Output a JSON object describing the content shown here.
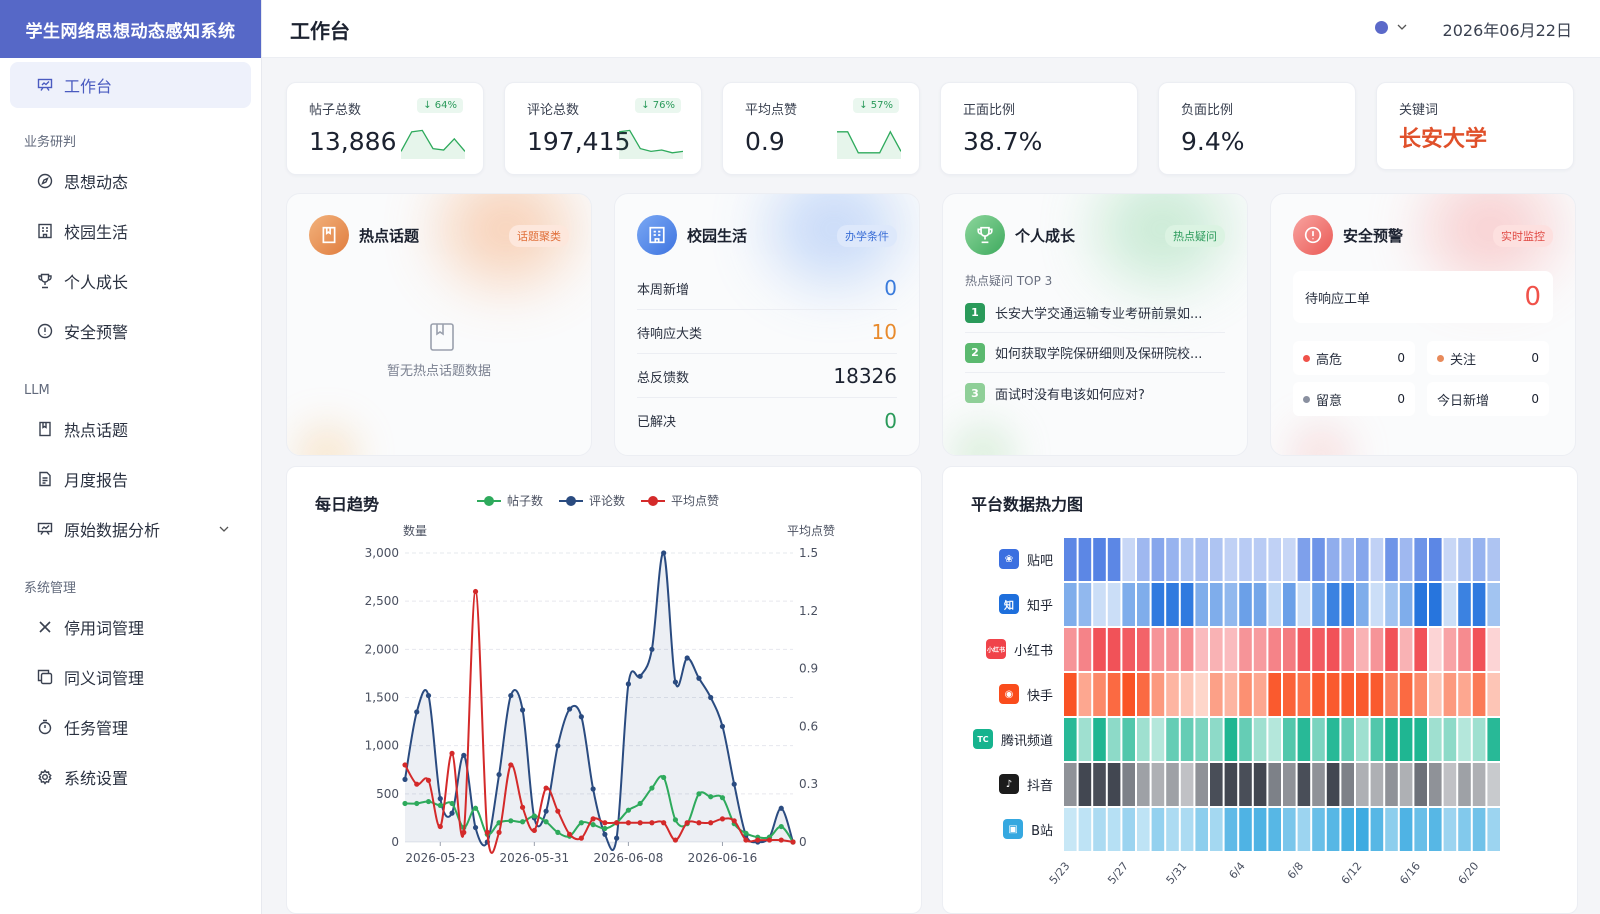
{
  "sidebar": {
    "brand": "学生网络思想动态感知系统",
    "active": "工作台",
    "groups": [
      {
        "title": "业务研判",
        "items": [
          "思想动态",
          "校园生活",
          "个人成长",
          "安全预警"
        ]
      },
      {
        "title": "LLM",
        "items": [
          "热点话题",
          "月度报告",
          "原始数据分析"
        ]
      },
      {
        "title": "系统管理",
        "items": [
          "停用词管理",
          "同义词管理",
          "任务管理",
          "系统设置"
        ]
      }
    ]
  },
  "header": {
    "title": "工作台",
    "date": "2026年06月22日"
  },
  "kpis": [
    {
      "label": "帖子总数",
      "value": "13,886",
      "badge": "↓ 64%",
      "spark": [
        0.2,
        0.9,
        0.95,
        0.3,
        0.25,
        0.65,
        0.2
      ]
    },
    {
      "label": "评论总数",
      "value": "197,415",
      "badge": "↓ 76%",
      "spark": [
        0.9,
        0.95,
        0.3,
        0.2,
        0.25,
        0.15,
        0.2
      ]
    },
    {
      "label": "平均点赞",
      "value": "0.9",
      "badge": "↓ 57%",
      "spark": [
        0.9,
        0.9,
        0.15,
        0.15,
        0.15,
        0.9,
        0.2
      ]
    },
    {
      "label": "正面比例",
      "value": "38.7%"
    },
    {
      "label": "负面比例",
      "value": "9.4%"
    },
    {
      "label": "关键词",
      "value": "长安大学"
    }
  ],
  "cards": {
    "hot": {
      "title": "热点话题",
      "tag": "话题聚类",
      "empty": "暂无热点话题数据"
    },
    "campus": {
      "title": "校园生活",
      "tag": "办学条件",
      "rows": [
        {
          "label": "本周新增",
          "value": "0",
          "color": "#3a7bdc"
        },
        {
          "label": "待响应大类",
          "value": "10",
          "color": "#e88a2c"
        },
        {
          "label": "总反馈数",
          "value": "18326",
          "color": "#1c2230"
        },
        {
          "label": "已解决",
          "value": "0",
          "color": "#2a9a5a"
        }
      ]
    },
    "growth": {
      "title": "个人成长",
      "tag": "热点疑问",
      "subtitle": "热点疑问 TOP 3",
      "items": [
        {
          "rank": "1",
          "text": "长安大学交通运输专业考研前景如..."
        },
        {
          "rank": "2",
          "text": "如何获取学院保研细则及保研院校..."
        },
        {
          "rank": "3",
          "text": "面试时没有电该如何应对?"
        }
      ]
    },
    "safety": {
      "title": "安全预警",
      "tag": "实时监控",
      "pending_label": "待响应工单",
      "pending_value": "0",
      "risks": [
        {
          "label": "高危",
          "value": "0",
          "color": "#f0524a"
        },
        {
          "label": "关注",
          "value": "0",
          "color": "#e88a5a"
        },
        {
          "label": "留意",
          "value": "0",
          "color": "#8a90a0"
        },
        {
          "label": "今日新增",
          "value": "0",
          "color": ""
        }
      ]
    }
  },
  "trend": {
    "title": "每日趋势",
    "y_left_title": "数量",
    "y_right_title": "平均点赞"
  },
  "heat": {
    "title": "平台数据热力图",
    "platforms": [
      "贴吧",
      "知乎",
      "小红书",
      "快手",
      "腾讯频道",
      "抖音",
      "B站"
    ],
    "x_labels": [
      "5/23",
      "5/27",
      "5/31",
      "6/4",
      "6/8",
      "6/12",
      "6/16",
      "6/20"
    ],
    "colors": [
      "#3b6fe0",
      "#1e6fdc",
      "#f0434a",
      "#fa4c1c",
      "#16b38e",
      "#3a3f4a",
      "#35a8e0"
    ],
    "intensity": [
      [
        0.8,
        0.8,
        0.85,
        0.8,
        0.15,
        0.4,
        0.55,
        0.45,
        0.3,
        0.35,
        0.3,
        0.2,
        0.25,
        0.25,
        0.2,
        0.15,
        0.6,
        0.7,
        0.5,
        0.4,
        0.55,
        0.2,
        0.7,
        0.4,
        0.7,
        0.8,
        0.15,
        0.3,
        0.45,
        0.3
      ],
      [
        0.5,
        0.4,
        0.1,
        0.1,
        0.5,
        0.5,
        0.9,
        0.9,
        0.9,
        0.5,
        0.5,
        0.4,
        0.6,
        0.55,
        0.15,
        0.6,
        0.1,
        0.6,
        0.85,
        0.85,
        0.5,
        0.1,
        0.3,
        0.5,
        0.95,
        0.95,
        0.1,
        0.85,
        0.9,
        0.3
      ],
      [
        0.5,
        0.6,
        0.9,
        0.9,
        0.85,
        0.8,
        0.5,
        0.5,
        0.55,
        0.25,
        0.3,
        0.25,
        0.5,
        0.45,
        0.6,
        0.65,
        0.85,
        0.85,
        0.9,
        0.6,
        0.3,
        0.5,
        0.9,
        0.3,
        0.9,
        0.1,
        0.4,
        0.55,
        0.9,
        0.1
      ],
      [
        0.95,
        0.4,
        0.6,
        0.8,
        0.95,
        0.8,
        0.5,
        0.3,
        0.2,
        0.1,
        0.45,
        0.3,
        0.55,
        0.4,
        0.9,
        0.85,
        0.75,
        0.9,
        0.9,
        0.9,
        0.9,
        0.9,
        0.65,
        0.8,
        0.6,
        0.2,
        0.5,
        0.4,
        0.7,
        0.2
      ],
      [
        0.9,
        0.3,
        0.95,
        0.4,
        0.7,
        0.3,
        0.2,
        0.6,
        0.6,
        0.5,
        0.4,
        0.95,
        0.6,
        0.3,
        0.2,
        0.7,
        0.9,
        0.5,
        0.9,
        0.6,
        0.3,
        0.7,
        0.95,
        0.95,
        0.95,
        0.3,
        0.4,
        0.2,
        0.3,
        0.9
      ],
      [
        0.5,
        0.95,
        0.9,
        0.95,
        0.6,
        0.4,
        0.3,
        0.4,
        0.2,
        0.5,
        0.9,
        0.95,
        0.9,
        0.95,
        0.6,
        0.5,
        0.9,
        0.5,
        0.95,
        0.6,
        0.3,
        0.3,
        0.5,
        0.3,
        0.7,
        0.5,
        0.2,
        0.4,
        0.3,
        0.15
      ],
      [
        0.15,
        0.2,
        0.3,
        0.25,
        0.4,
        0.2,
        0.45,
        0.3,
        0.3,
        0.5,
        0.35,
        0.75,
        0.85,
        0.85,
        0.8,
        0.6,
        0.4,
        0.7,
        0.8,
        0.9,
        0.95,
        0.8,
        0.5,
        0.85,
        0.7,
        0.8,
        0.4,
        0.55,
        0.65,
        0.4
      ]
    ]
  },
  "chart_data": {
    "type": "line",
    "title": "每日趋势",
    "x": [
      "2026-05-20",
      "2026-05-21",
      "2026-05-22",
      "2026-05-23",
      "2026-05-24",
      "2026-05-25",
      "2026-05-26",
      "2026-05-27",
      "2026-05-28",
      "2026-05-29",
      "2026-05-30",
      "2026-05-31",
      "2026-06-01",
      "2026-06-02",
      "2026-06-03",
      "2026-06-04",
      "2026-06-05",
      "2026-06-06",
      "2026-06-07",
      "2026-06-08",
      "2026-06-09",
      "2026-06-10",
      "2026-06-11",
      "2026-06-12",
      "2026-06-13",
      "2026-06-14",
      "2026-06-15",
      "2026-06-16",
      "2026-06-17",
      "2026-06-18",
      "2026-06-19",
      "2026-06-20",
      "2026-06-21",
      "2026-06-22"
    ],
    "x_ticks": [
      "2026-05-23",
      "2026-05-31",
      "2026-06-08",
      "2026-06-16"
    ],
    "y_left": {
      "label": "数量",
      "lim": [
        0,
        3000
      ],
      "ticks": [
        0,
        500,
        1000,
        1500,
        2000,
        2500,
        3000
      ]
    },
    "y_right": {
      "label": "平均点赞",
      "lim": [
        0,
        1.5
      ],
      "ticks": [
        0,
        0.3,
        0.6,
        0.9,
        1.2,
        1.5
      ]
    },
    "series": [
      {
        "name": "帖子数",
        "axis": "left",
        "color": "#2eaa5c",
        "values": [
          400,
          400,
          420,
          380,
          400,
          150,
          350,
          80,
          200,
          220,
          210,
          270,
          210,
          100,
          60,
          200,
          180,
          140,
          200,
          330,
          400,
          560,
          670,
          230,
          190,
          500,
          470,
          460,
          190,
          90,
          50,
          50,
          160,
          0
        ]
      },
      {
        "name": "评论数",
        "axis": "left",
        "color": "#2a4b80",
        "values": [
          650,
          1350,
          1520,
          450,
          300,
          900,
          150,
          0,
          700,
          1520,
          1370,
          250,
          320,
          1000,
          1380,
          1300,
          550,
          80,
          40,
          1640,
          1720,
          2000,
          3000,
          1660,
          1910,
          1700,
          1500,
          1200,
          600,
          70,
          0,
          50,
          350,
          0
        ]
      },
      {
        "name": "平均点赞",
        "axis": "right",
        "color": "#d42a2a",
        "values": [
          0.4,
          0.3,
          0.32,
          0.08,
          0.46,
          0.05,
          1.3,
          0.05,
          0.05,
          0.4,
          0.18,
          0.06,
          0.28,
          0.16,
          0.04,
          0.02,
          0.12,
          0.1,
          0.1,
          0.1,
          0.1,
          0.1,
          0.1,
          0.01,
          0.1,
          0.1,
          0.1,
          0.12,
          0.11,
          0.01,
          0.01,
          0.01,
          0.01,
          0.0
        ]
      }
    ]
  }
}
